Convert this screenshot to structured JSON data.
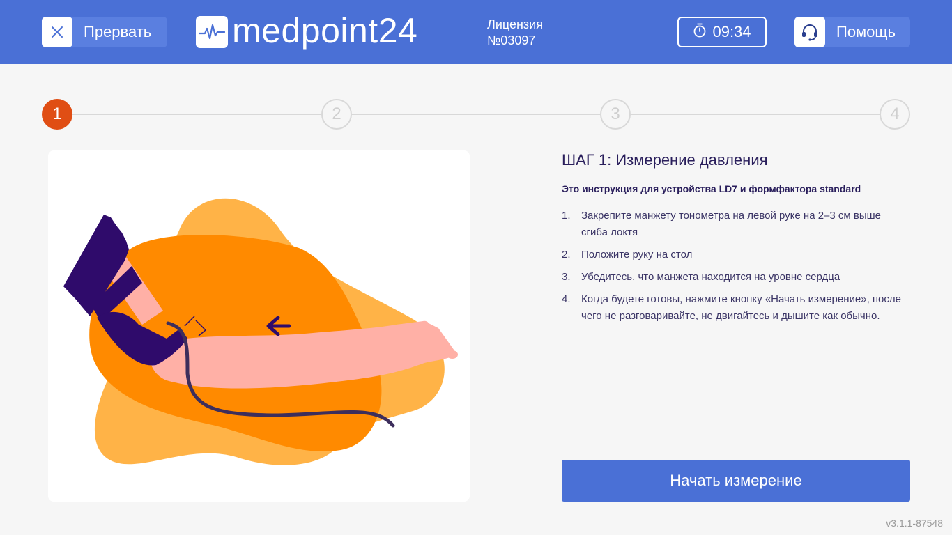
{
  "header": {
    "abort_label": "Прервать",
    "logo_text": "medpoint24",
    "license_line1": "Лицензия",
    "license_line2": "№03097",
    "timer": "09:34",
    "help_label": "Помощь"
  },
  "stepper": {
    "current": 1,
    "steps": [
      "1",
      "2",
      "3",
      "4"
    ]
  },
  "instruction": {
    "title": "ШАГ 1: Измерение давления",
    "subtitle": "Это инструкция для устройства LD7 и формфактора standard",
    "items": [
      {
        "num": "1.",
        "text": "Закрепите манжету тонометра на левой руке на 2–3 см выше сгиба локтя"
      },
      {
        "num": "2.",
        "text": "Положите руку на стол"
      },
      {
        "num": "3.",
        "text": "Убедитесь, что манжета находится на уровне сердца"
      },
      {
        "num": "4.",
        "text": "Когда будете готовы, нажмите кнопку «Начать измерение», после чего не разговаривайте, не двигайтесь и дышите как обычно."
      }
    ]
  },
  "start_button": "Начать измерение",
  "version": "v3.1.1-87548",
  "colors": {
    "brand": "#4a70d6",
    "active_step": "#e04e14",
    "text_dark": "#2a1f5c",
    "blob_light": "#ffb347",
    "blob_dark": "#ff8a00",
    "skin": "#ffb0a6",
    "sleeve": "#2f0b6b"
  },
  "icons": {
    "abort": "close-icon",
    "logo": "heartbeat-icon",
    "timer": "stopwatch-icon",
    "help": "headset-icon"
  }
}
